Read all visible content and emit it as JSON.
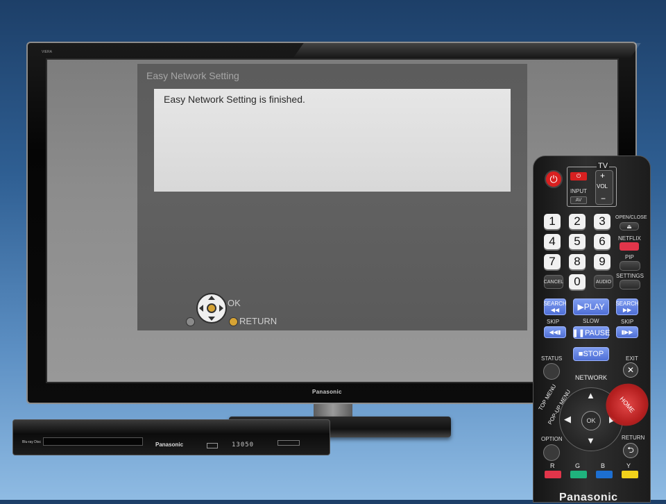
{
  "tv": {
    "brand": "Panasonic",
    "model": "VIERA"
  },
  "dialog": {
    "title": "Easy Network Setting",
    "message": "Easy Network Setting is finished.",
    "ok_label": "OK",
    "return_label": "RETURN"
  },
  "player": {
    "brand": "Panasonic",
    "logo": "Blu-ray Disc",
    "display": "13050"
  },
  "remote": {
    "tv_label": "TV",
    "input_label": "INPUT",
    "av_label": "AV",
    "vol_label": "VOL",
    "vol_plus": "+",
    "vol_minus": "−",
    "numbers": [
      "1",
      "2",
      "3",
      "4",
      "5",
      "6",
      "7",
      "8",
      "9",
      "0"
    ],
    "open_close": "OPEN/CLOSE",
    "netflix": "NETFLIX",
    "pip": "PIP",
    "settings": "SETTINGS",
    "cancel": "CANCEL",
    "audio": "AUDIO",
    "search_back": "SEARCH",
    "play": "▶PLAY",
    "search_fwd": "SEARCH",
    "skip_left": "SKIP",
    "slow": "SLOW",
    "skip_right": "SKIP",
    "pause": "❚❚PAUSE",
    "status": "STATUS",
    "stop": "■STOP",
    "exit": "EXIT",
    "network": "NETWORK",
    "top_menu": "TOP MENU",
    "popup_menu": "POP-UP MENU",
    "home": "HOME",
    "ok": "OK",
    "option": "OPTION",
    "return": "RETURN",
    "color_labels": [
      "R",
      "G",
      "B",
      "Y"
    ],
    "brand": "Panasonic"
  }
}
